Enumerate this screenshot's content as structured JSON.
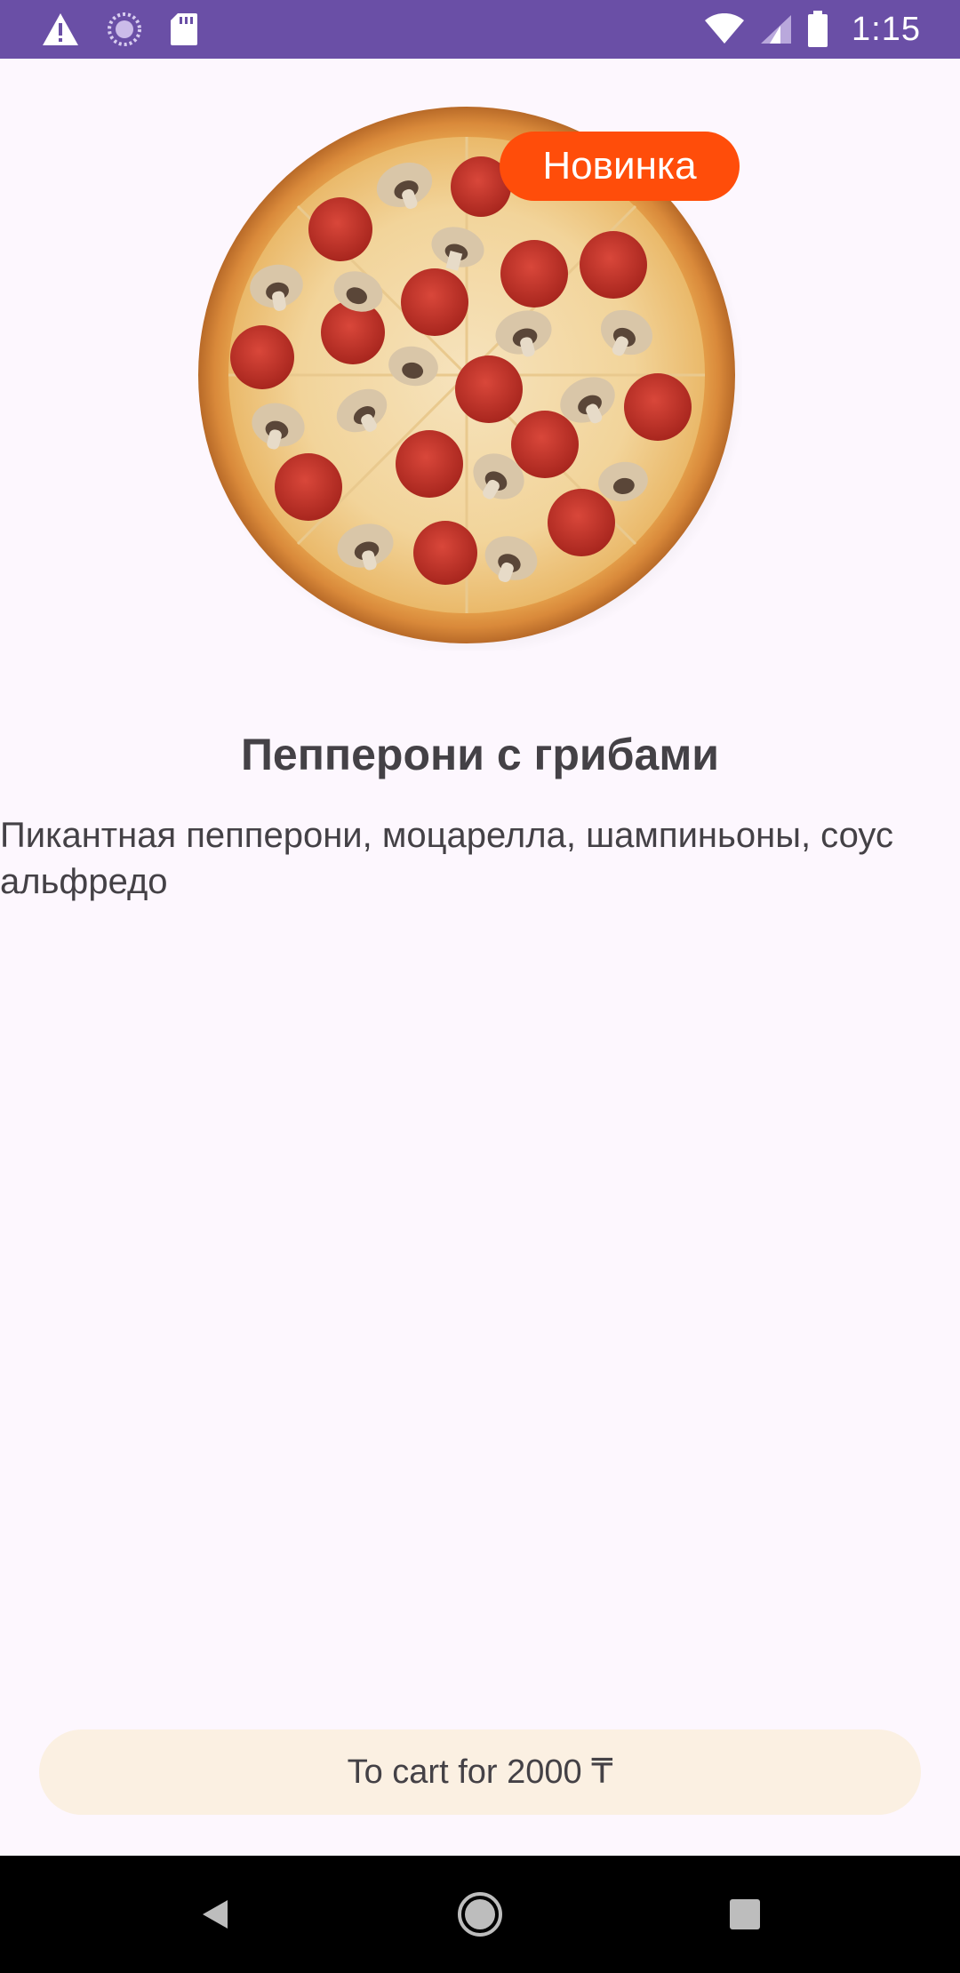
{
  "status_bar": {
    "time": "1:15",
    "icons": [
      "warning-icon",
      "sync-icon",
      "sd-card-icon",
      "wifi-icon",
      "signal-icon",
      "battery-icon"
    ]
  },
  "product": {
    "badge": "Новинка",
    "title": "Пепперони с грибами",
    "description": "Пикантная пепперони, моцарелла, шампиньоны, соус альфредо",
    "image_icon": "pizza-image"
  },
  "cart_button": {
    "label": "To cart for 2000 ₸"
  },
  "nav_bar": {
    "icons": [
      "back-icon",
      "home-icon",
      "recents-icon"
    ]
  },
  "colors": {
    "status_bar": "#6a4fa6",
    "background": "#fdf7fe",
    "badge": "#ff4d0a",
    "button": "#fbf0e2",
    "text": "#444146"
  }
}
